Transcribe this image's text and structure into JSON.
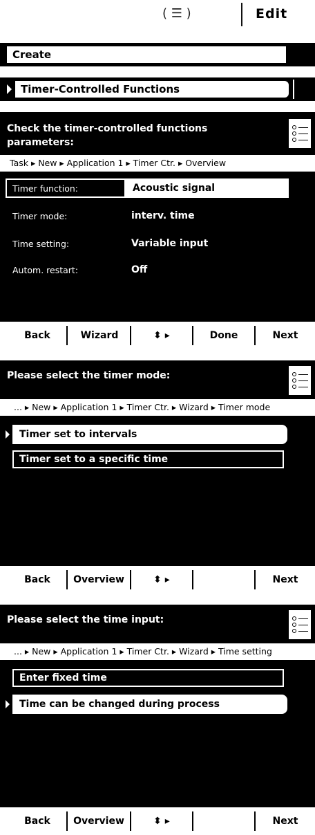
{
  "topbar": {
    "menu_icon": "list-menu-icon",
    "menu_glyph": "( ☰ )",
    "edit_label": "Edit"
  },
  "strip_create": {
    "label": "Create"
  },
  "strip_timer": {
    "label": "Timer-Controlled Functions"
  },
  "screen1": {
    "title_line1": "Check the timer-controlled functions",
    "title_line2": "parameters:",
    "breadcrumb": "Task ▸ New ▸ Application 1 ▸ Timer Ctr. ▸ Overview",
    "rows": [
      {
        "label": "Timer function:",
        "value": "Acoustic signal"
      },
      {
        "label": "Timer mode:",
        "value": "interv. time"
      },
      {
        "label": "Time setting:",
        "value": "Variable input"
      },
      {
        "label": "Autom. restart:",
        "value": "Off"
      }
    ],
    "softkeys": [
      "Back",
      "Wizard",
      "⬍ ▸",
      "Done",
      "Next"
    ]
  },
  "screen2": {
    "title": "Please select the timer mode:",
    "breadcrumb": "... ▸ New ▸ Application 1 ▸ Timer Ctr. ▸ Wizard ▸ Timer mode",
    "options": [
      "Timer set to intervals",
      "Timer set to a specific time"
    ],
    "softkeys": [
      "Back",
      "Overview",
      "⬍ ▸",
      "",
      "Next"
    ]
  },
  "screen3": {
    "title": "Please select the time input:",
    "breadcrumb": "... ▸ New ▸ Application 1 ▸ Timer Ctr. ▸ Wizard ▸ Time setting",
    "options": [
      "Enter fixed time",
      "Time can be changed during process"
    ],
    "softkeys": [
      "Back",
      "Overview",
      "⬍ ▸",
      "",
      "Next"
    ]
  }
}
